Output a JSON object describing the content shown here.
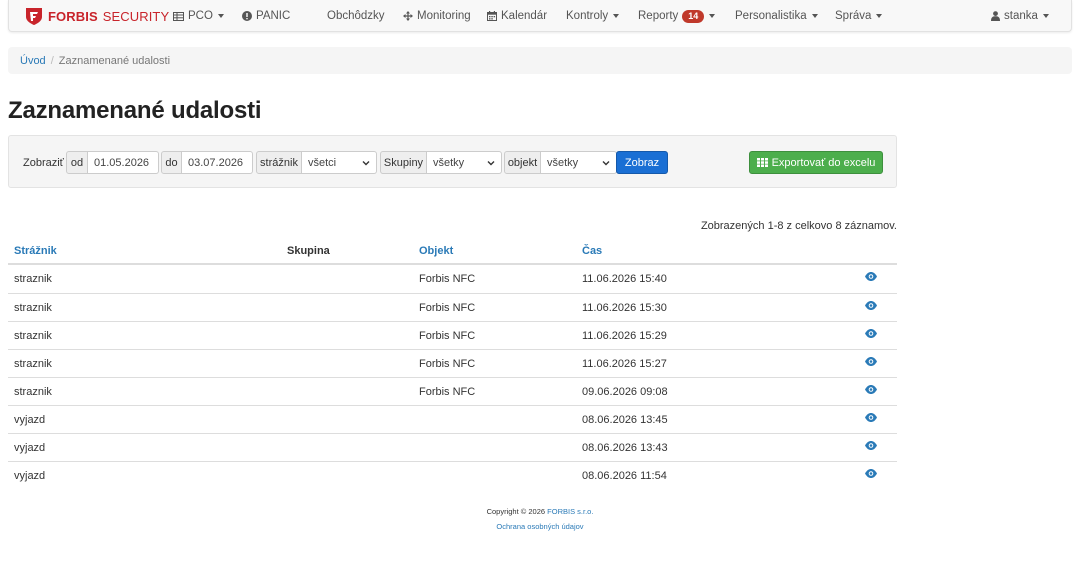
{
  "brand": {
    "name_bold": "FORBIS",
    "name_light": "SECURITY"
  },
  "nav": {
    "pco": "PCO",
    "panic": "PANIC",
    "obchodzky": "Obchôdzky",
    "monitoring": "Monitoring",
    "kalendar": "Kalendár",
    "kontroly": "Kontroly",
    "reporty": "Reporty",
    "reporty_badge": "14",
    "personalistika": "Personalistika",
    "sprava": "Správa",
    "user": "stanka"
  },
  "breadcrumb": {
    "home": "Úvod",
    "separator": "/",
    "current": "Zaznamenané udalosti"
  },
  "page_title": "Zaznamenané udalosti",
  "filter": {
    "show_label": "Zobraziť",
    "from_label": "od",
    "from_value": "01.05.2026",
    "to_label": "do",
    "to_value": "03.07.2026",
    "guard_label": "strážnik",
    "guard_value": "všetci",
    "groups_label": "Skupiny",
    "groups_value": "všetky",
    "object_label": "objekt",
    "object_value": "všetky",
    "submit_label": "Zobraz",
    "export_label": "Exportovať do excelu"
  },
  "summary": "Zobrazených 1-8 z celkovo 8 záznamov.",
  "table": {
    "headers": {
      "guard": "Strážnik",
      "group": "Skupina",
      "object": "Objekt",
      "time": "Čas"
    },
    "rows": [
      {
        "guard": "straznik",
        "group": "",
        "object": "Forbis NFC",
        "time": "11.06.2026 15:40"
      },
      {
        "guard": "straznik",
        "group": "",
        "object": "Forbis NFC",
        "time": "11.06.2026 15:30"
      },
      {
        "guard": "straznik",
        "group": "",
        "object": "Forbis NFC",
        "time": "11.06.2026 15:29"
      },
      {
        "guard": "straznik",
        "group": "",
        "object": "Forbis NFC",
        "time": "11.06.2026 15:27"
      },
      {
        "guard": "straznik",
        "group": "",
        "object": "Forbis NFC",
        "time": "09.06.2026 09:08"
      },
      {
        "guard": "vyjazd",
        "group": "",
        "object": "",
        "time": "08.06.2026 13:45"
      },
      {
        "guard": "vyjazd",
        "group": "",
        "object": "",
        "time": "08.06.2026 13:43"
      },
      {
        "guard": "vyjazd",
        "group": "",
        "object": "",
        "time": "08.06.2026 11:54"
      }
    ]
  },
  "footer": {
    "copyright_prefix": "Copyright © 2026",
    "company": "FORBIS s.r.o.",
    "privacy": "Ochrana osobných údajov"
  },
  "colors": {
    "brand_red": "#c8242b",
    "link_blue": "#2a7ab7",
    "primary_button": "#1a6fd4",
    "success_button": "#4cae4c",
    "badge_red": "#c0392b"
  },
  "icons": [
    "shield-logo-icon",
    "table-icon",
    "exclamation-circle-icon",
    "move-arrows-icon",
    "calendar-icon",
    "user-icon",
    "grid-icon",
    "eye-icon"
  ]
}
